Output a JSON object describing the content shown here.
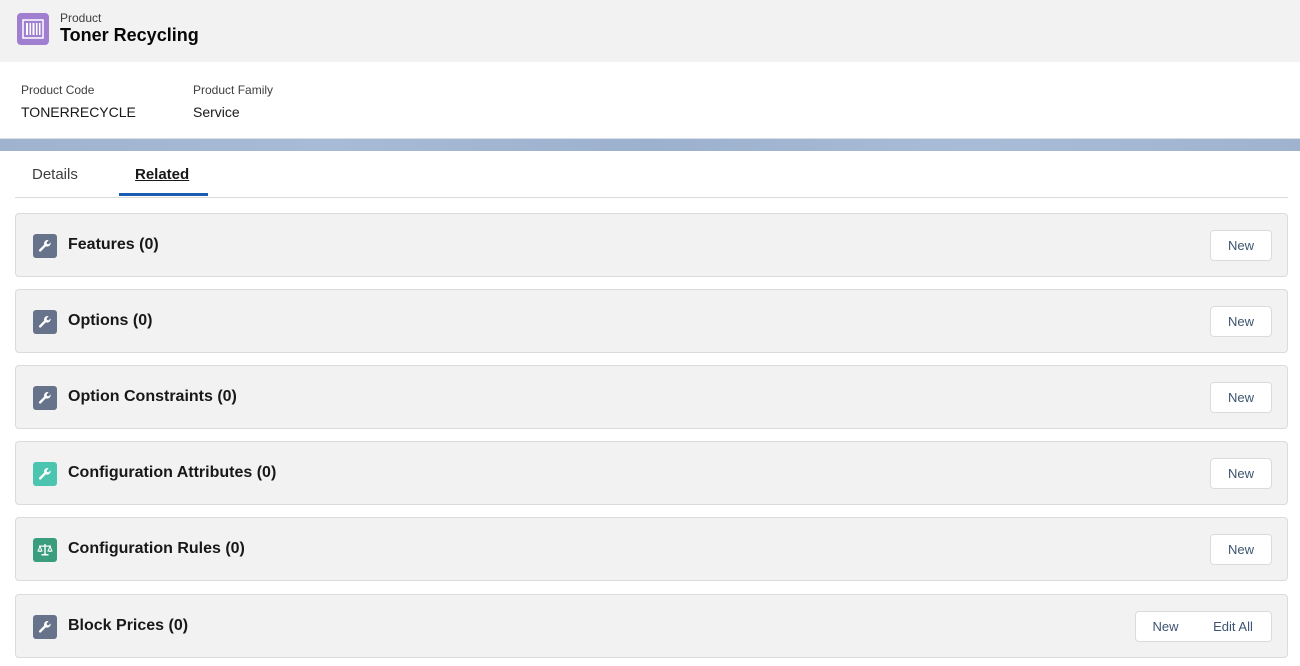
{
  "header": {
    "object_label": "Product",
    "title": "Toner Recycling",
    "icon": "product-barcode-icon",
    "icon_color": "#a07fd0"
  },
  "highlights": {
    "fields": [
      {
        "label": "Product Code",
        "value": "TONERRECYCLE"
      },
      {
        "label": "Product Family",
        "value": "Service"
      }
    ]
  },
  "tabs": [
    {
      "label": "Details",
      "active": false
    },
    {
      "label": "Related",
      "active": true
    }
  ],
  "related_lists": [
    {
      "title": "Features (0)",
      "icon": "wrench-icon",
      "icon_color": "#66738a",
      "buttons": [
        "New"
      ]
    },
    {
      "title": "Options (0)",
      "icon": "wrench-icon",
      "icon_color": "#66738a",
      "buttons": [
        "New"
      ]
    },
    {
      "title": "Option Constraints (0)",
      "icon": "wrench-icon",
      "icon_color": "#66738a",
      "buttons": [
        "New"
      ]
    },
    {
      "title": "Configuration Attributes (0)",
      "icon": "wrench-icon",
      "icon_color": "#4bc5b0",
      "buttons": [
        "New"
      ]
    },
    {
      "title": "Configuration Rules (0)",
      "icon": "scales-icon",
      "icon_color": "#3a9e7e",
      "buttons": [
        "New"
      ]
    },
    {
      "title": "Block Prices (0)",
      "icon": "wrench-icon",
      "icon_color": "#66738a",
      "buttons": [
        "New",
        "Edit All"
      ]
    }
  ]
}
